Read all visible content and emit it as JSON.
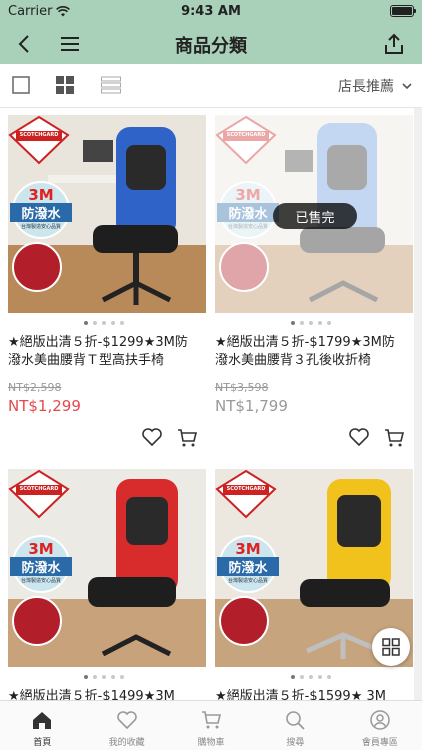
{
  "status_bar": {
    "carrier": "Carrier",
    "time": "9:43 AM"
  },
  "nav": {
    "title": "商品分類"
  },
  "toolbar": {
    "sort_label": "店長推薦"
  },
  "products": [
    {
      "name": "★絕版出清５折-$1299★3M防潑水美曲腰背Ｔ型高扶手椅",
      "orig_price": "NT$2,598",
      "price": "NT$1,299",
      "sold_out": false,
      "color": "#2f63c8"
    },
    {
      "name": "★絕版出清５折-$1799★3M防潑水美曲腰背３孔後收折椅",
      "orig_price": "NT$3,598",
      "price": "NT$1,799",
      "sold_out": true,
      "sold_out_label": "已售完",
      "color": "#6a9be0"
    },
    {
      "name": "★絕版出清５折-$1499★3M",
      "orig_price": "",
      "price": "",
      "sold_out": false,
      "color": "#d82b2b"
    },
    {
      "name": "★絕版出清５折-$1599★ 3M",
      "orig_price": "",
      "price": "",
      "sold_out": false,
      "color": "#f1c21b"
    }
  ],
  "badge": {
    "brand": "SCOTCHGARD",
    "line1": "3M",
    "line2": "防潑水",
    "line3": "台灣製造安心品質"
  },
  "tab_bar": {
    "items": [
      {
        "label": "首頁",
        "icon": "home-icon",
        "active": true
      },
      {
        "label": "我的收藏",
        "icon": "heart-icon",
        "active": false
      },
      {
        "label": "購物車",
        "icon": "cart-icon",
        "active": false
      },
      {
        "label": "搜尋",
        "icon": "search-icon",
        "active": false
      },
      {
        "label": "會員專區",
        "icon": "user-icon",
        "active": false
      }
    ]
  },
  "colors": {
    "header_bg": "#a9d0b9",
    "price_red": "#e5484d"
  }
}
